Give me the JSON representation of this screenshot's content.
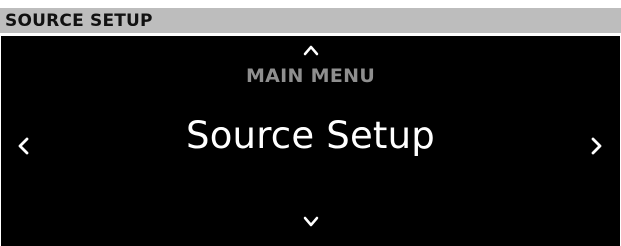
{
  "window": {
    "title": "SOURCE SETUP"
  },
  "menu": {
    "parent_label": "MAIN MENU",
    "current_label": "Source Setup"
  },
  "icons": {
    "up": "chevron-up-icon",
    "down": "chevron-down-icon",
    "left": "chevron-left-icon",
    "right": "chevron-right-icon"
  },
  "colors": {
    "title_bar_background": "#bdbdbd",
    "screen_background": "#000000",
    "parent_label": "#8f8f8f",
    "current_label": "#ffffff",
    "chevrons": "#ffffff"
  }
}
